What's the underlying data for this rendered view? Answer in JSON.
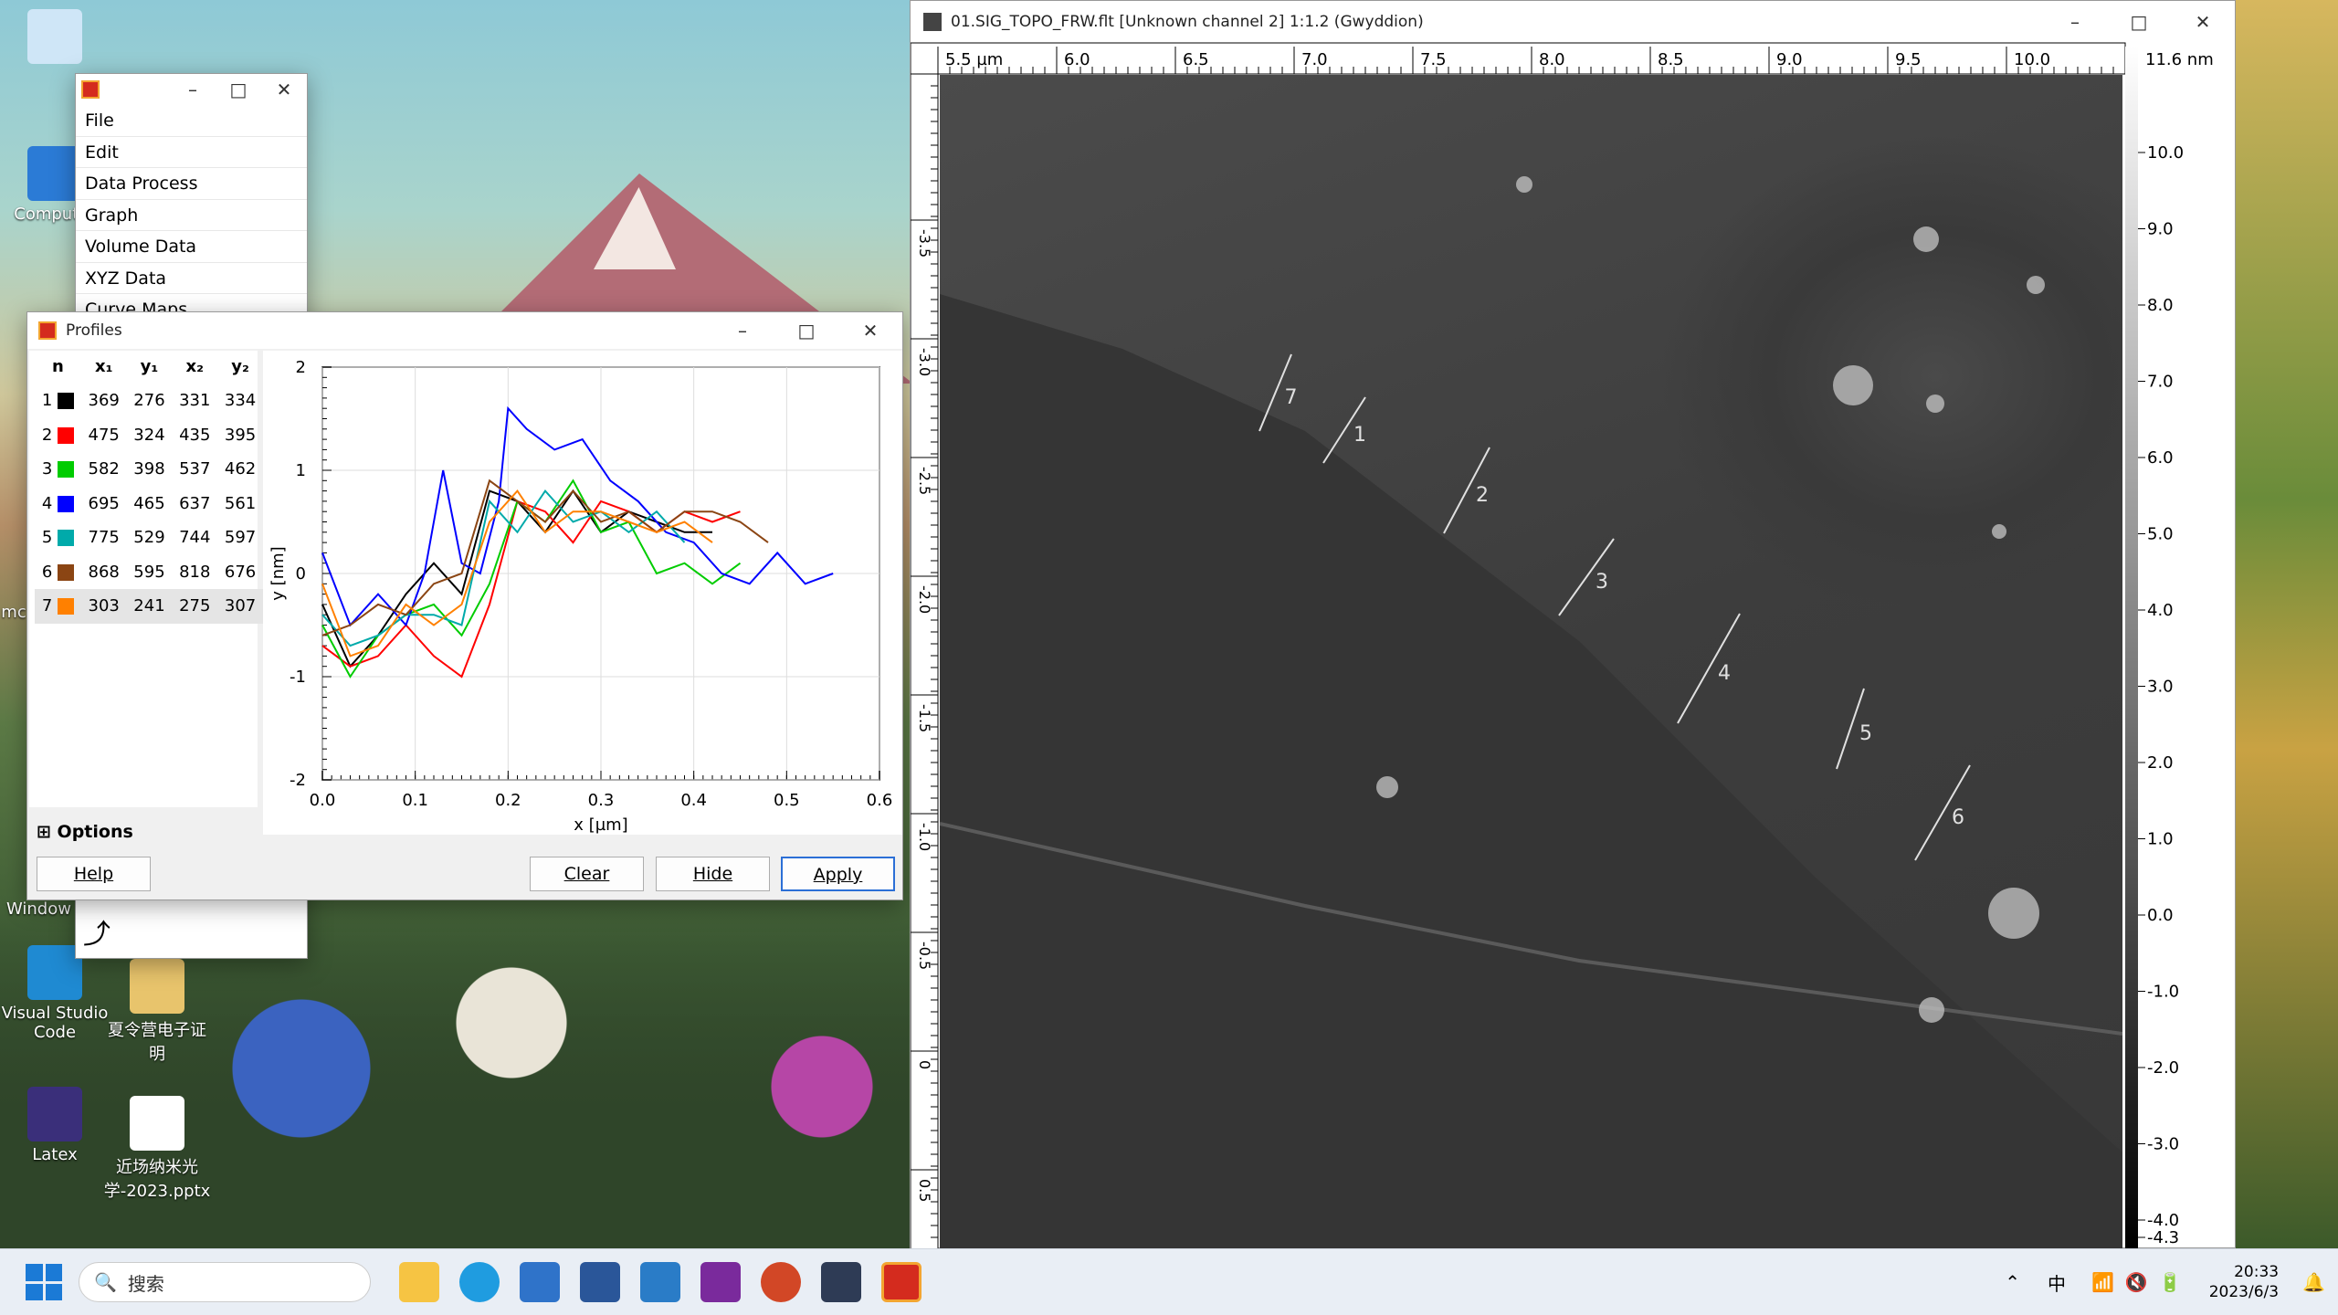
{
  "desktop": {
    "icons": [
      {
        "label": "Computer",
        "color": "#2b7bd6"
      },
      {
        "label": "Visual Studio Code",
        "color": "#1f8ad2"
      },
      {
        "label": "夏令营电子证明",
        "color": "#e8c46c"
      },
      {
        "label": "Latex",
        "color": "#3a2f7a"
      },
      {
        "label": "近场纳米光学-2023.pptx",
        "color": "#ee7b36"
      }
    ],
    "partial_labels": [
      "mc",
      "Window"
    ]
  },
  "gwy_main": {
    "menu": [
      "File",
      "Edit",
      "Data Process",
      "Graph",
      "Volume Data",
      "XYZ Data",
      "Curve Maps"
    ]
  },
  "profiles": {
    "title": "Profiles",
    "headers": [
      "n",
      "x₁",
      "y₁",
      "x₂",
      "y₂"
    ],
    "rows": [
      {
        "n": "1",
        "color": "#000000",
        "x1": "369",
        "y1": "276",
        "x2": "331",
        "y2": "334"
      },
      {
        "n": "2",
        "color": "#ff0000",
        "x1": "475",
        "y1": "324",
        "x2": "435",
        "y2": "395"
      },
      {
        "n": "3",
        "color": "#00cc00",
        "x1": "582",
        "y1": "398",
        "x2": "537",
        "y2": "462"
      },
      {
        "n": "4",
        "color": "#0000ff",
        "x1": "695",
        "y1": "465",
        "x2": "637",
        "y2": "561"
      },
      {
        "n": "5",
        "color": "#00aaaa",
        "x1": "775",
        "y1": "529",
        "x2": "744",
        "y2": "597"
      },
      {
        "n": "6",
        "color": "#8b4513",
        "x1": "868",
        "y1": "595",
        "x2": "818",
        "y2": "676"
      },
      {
        "n": "7",
        "color": "#ff8000",
        "x1": "303",
        "y1": "241",
        "x2": "275",
        "y2": "307"
      }
    ],
    "options_label": "Options",
    "buttons": {
      "help": "Help",
      "clear": "Clear",
      "hide": "Hide",
      "apply": "Apply"
    }
  },
  "chart_data": {
    "type": "line",
    "xlabel": "x [µm]",
    "ylabel": "y [nm]",
    "xlim": [
      0,
      0.6
    ],
    "ylim": [
      -2,
      2
    ],
    "xticks": [
      "0.0",
      "0.1",
      "0.2",
      "0.3",
      "0.4",
      "0.5",
      "0.6"
    ],
    "yticks": [
      "2",
      "1",
      "0",
      "-1",
      "-2"
    ],
    "series": [
      {
        "name": "1",
        "color": "#000000",
        "x": [
          0,
          0.03,
          0.06,
          0.09,
          0.12,
          0.15,
          0.18,
          0.21,
          0.24,
          0.27,
          0.3,
          0.33,
          0.36,
          0.39,
          0.42
        ],
        "y": [
          -0.3,
          -0.9,
          -0.6,
          -0.2,
          0.1,
          -0.2,
          0.8,
          0.7,
          0.4,
          0.8,
          0.4,
          0.6,
          0.5,
          0.4,
          0.4
        ]
      },
      {
        "name": "2",
        "color": "#ff0000",
        "x": [
          0,
          0.03,
          0.06,
          0.09,
          0.12,
          0.15,
          0.18,
          0.21,
          0.24,
          0.27,
          0.3,
          0.33,
          0.36,
          0.39,
          0.42,
          0.45
        ],
        "y": [
          -0.7,
          -0.9,
          -0.8,
          -0.5,
          -0.8,
          -1.0,
          -0.3,
          0.7,
          0.6,
          0.3,
          0.7,
          0.6,
          0.4,
          0.6,
          0.5,
          0.6
        ]
      },
      {
        "name": "3",
        "color": "#00cc00",
        "x": [
          0,
          0.03,
          0.06,
          0.09,
          0.12,
          0.15,
          0.18,
          0.21,
          0.24,
          0.27,
          0.3,
          0.33,
          0.36,
          0.39,
          0.42,
          0.45
        ],
        "y": [
          -0.5,
          -1.0,
          -0.6,
          -0.4,
          -0.3,
          -0.6,
          -0.1,
          0.7,
          0.5,
          0.9,
          0.4,
          0.5,
          0.0,
          0.1,
          -0.1,
          0.1
        ]
      },
      {
        "name": "4",
        "color": "#0000ff",
        "x": [
          0,
          0.03,
          0.06,
          0.09,
          0.11,
          0.13,
          0.15,
          0.17,
          0.19,
          0.2,
          0.22,
          0.25,
          0.28,
          0.31,
          0.34,
          0.37,
          0.4,
          0.43,
          0.46,
          0.49,
          0.52,
          0.55
        ],
        "y": [
          0.2,
          -0.5,
          -0.2,
          -0.5,
          0.0,
          1.0,
          0.1,
          0.0,
          0.7,
          1.6,
          1.4,
          1.2,
          1.3,
          0.9,
          0.7,
          0.4,
          0.3,
          0.0,
          -0.1,
          0.2,
          -0.1,
          0.0
        ]
      },
      {
        "name": "5",
        "color": "#00aaaa",
        "x": [
          0,
          0.03,
          0.06,
          0.09,
          0.12,
          0.15,
          0.18,
          0.21,
          0.24,
          0.27,
          0.3,
          0.33,
          0.36,
          0.39
        ],
        "y": [
          -0.4,
          -0.7,
          -0.6,
          -0.4,
          -0.4,
          -0.5,
          0.7,
          0.4,
          0.8,
          0.5,
          0.6,
          0.4,
          0.6,
          0.3
        ]
      },
      {
        "name": "6",
        "color": "#8b4513",
        "x": [
          0,
          0.03,
          0.06,
          0.09,
          0.12,
          0.15,
          0.18,
          0.21,
          0.24,
          0.27,
          0.3,
          0.33,
          0.36,
          0.39,
          0.42,
          0.45,
          0.48
        ],
        "y": [
          -0.6,
          -0.5,
          -0.3,
          -0.4,
          -0.1,
          0.0,
          0.9,
          0.7,
          0.5,
          0.8,
          0.5,
          0.6,
          0.4,
          0.6,
          0.6,
          0.5,
          0.3
        ]
      },
      {
        "name": "7",
        "color": "#ff8000",
        "x": [
          0,
          0.03,
          0.06,
          0.09,
          0.12,
          0.15,
          0.18,
          0.21,
          0.24,
          0.27,
          0.3,
          0.33,
          0.36,
          0.39,
          0.42
        ],
        "y": [
          -0.1,
          -0.8,
          -0.7,
          -0.3,
          -0.5,
          -0.3,
          0.5,
          0.8,
          0.4,
          0.6,
          0.6,
          0.5,
          0.4,
          0.5,
          0.3
        ]
      }
    ]
  },
  "gwyddion_view": {
    "title": "01.SIG_TOPO_FRW.flt [Unknown channel 2] 1:1.2 (Gwyddion)",
    "hruler": [
      "5.5 µm",
      "6.0",
      "6.5",
      "7.0",
      "7.5",
      "8.0",
      "8.5",
      "9.0",
      "9.5",
      "10.0"
    ],
    "vruler": [
      "-3.5",
      "-3.0",
      "-2.5",
      "-2.0",
      "-1.5",
      "-1.0",
      "-0.5",
      "0",
      "0.5"
    ],
    "colorbar_max": "11.6 nm",
    "colorbar_ticks": [
      "10.0",
      "9.0",
      "8.0",
      "7.0",
      "6.0",
      "5.0",
      "4.0",
      "3.0",
      "2.0",
      "1.0",
      "0.0",
      "-1.0",
      "-2.0",
      "-3.0",
      "-4.0",
      "-4.3"
    ],
    "line_labels": [
      "7",
      "1",
      "2",
      "3",
      "4",
      "5",
      "6"
    ]
  },
  "taskbar": {
    "search_placeholder": "搜索",
    "ime": "中",
    "time": "20:33",
    "date": "2023/6/3"
  }
}
